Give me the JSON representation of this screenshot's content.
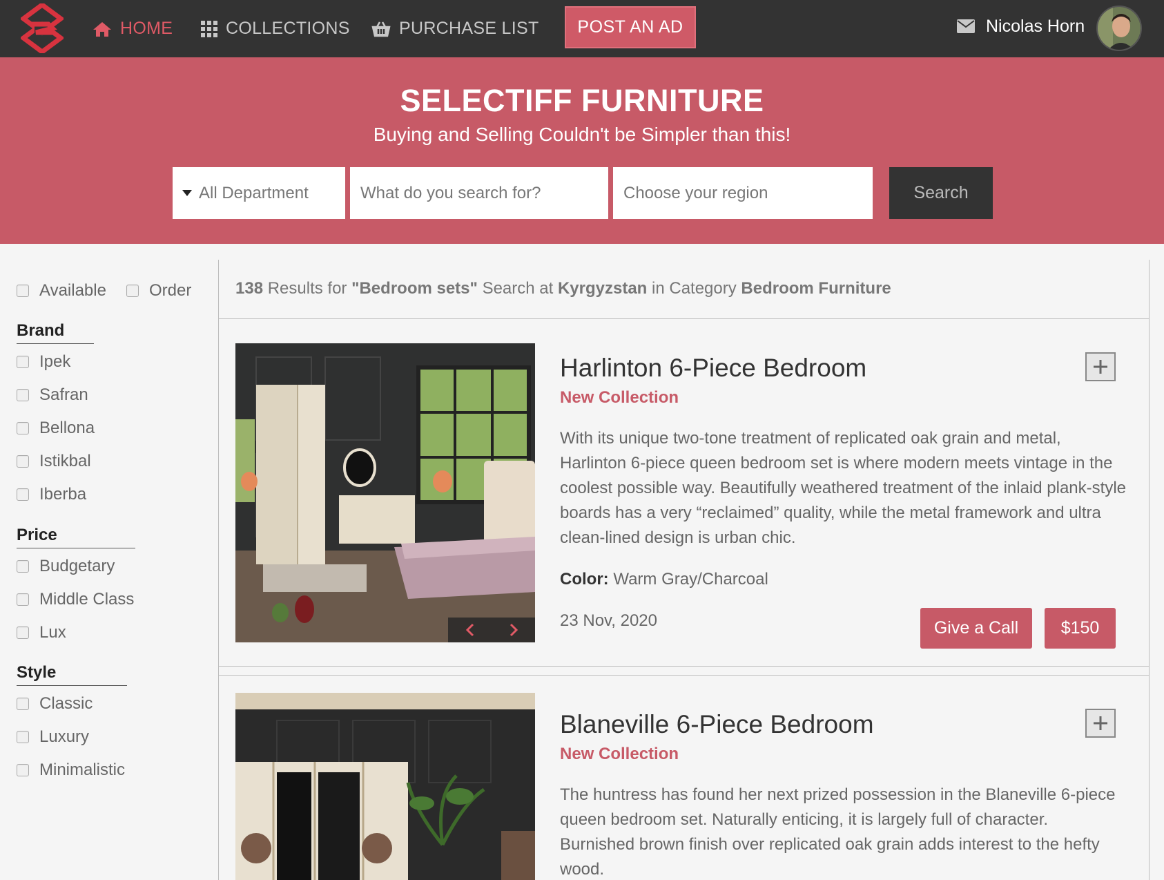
{
  "nav": {
    "home": "HOME",
    "collections": "COLLECTIONS",
    "purchase_list": "PURCHASE LIST",
    "post_ad": "POST AN AD",
    "user_name": "Nicolas Horn"
  },
  "hero": {
    "title": "SELECTIFF FURNITURE",
    "subtitle": "Buying and Selling Couldn't be Simpler than this!",
    "department": "All Department",
    "search_placeholder": "What do you search for?",
    "region_placeholder": "Choose your region",
    "search_button": "Search"
  },
  "filters": {
    "availability": [
      "Available",
      "Order"
    ],
    "brand_title": "Brand",
    "brands": [
      "Ipek",
      "Safran",
      "Bellona",
      "Istikbal",
      "Iberba"
    ],
    "price_title": "Price",
    "prices": [
      "Budgetary",
      "Middle Class",
      "Lux"
    ],
    "style_title": "Style",
    "styles": [
      "Classic",
      "Luxury",
      "Minimalistic"
    ]
  },
  "results": {
    "count": "138",
    "text1": " Results for ",
    "query": "\"Bedroom sets\"",
    "text2": " Search at ",
    "region": "Kyrgyzstan",
    "text3": " in Category ",
    "category": "Bedroom Furniture"
  },
  "products": [
    {
      "title": "Harlinton 6-Piece Bedroom",
      "tag": "New Collection",
      "description": "With its unique two-tone treatment of replicated oak grain and metal, Harlinton 6-piece queen bedroom set is where modern meets vintage in the coolest possible way. Beautifully weathered treatment of the inlaid plank-style boards has a very “reclaimed” quality, while the metal framework and ultra clean-lined design is urban chic.",
      "color_label": "Color:",
      "color_value": " Warm Gray/Charcoal",
      "date": "23 Nov, 2020",
      "call_button": "Give a Call",
      "price": "$150"
    },
    {
      "title": "Blaneville 6-Piece Bedroom",
      "tag": "New Collection",
      "description": "The huntress has found her next prized possession in the Blaneville 6-piece queen bedroom set. Naturally enticing, it is largely full of character. Burnished brown finish over replicated oak grain adds interest to the hefty wood."
    }
  ],
  "colors": {
    "accent": "#c75a67",
    "navbar": "#333333",
    "background": "#f5f5f5"
  }
}
